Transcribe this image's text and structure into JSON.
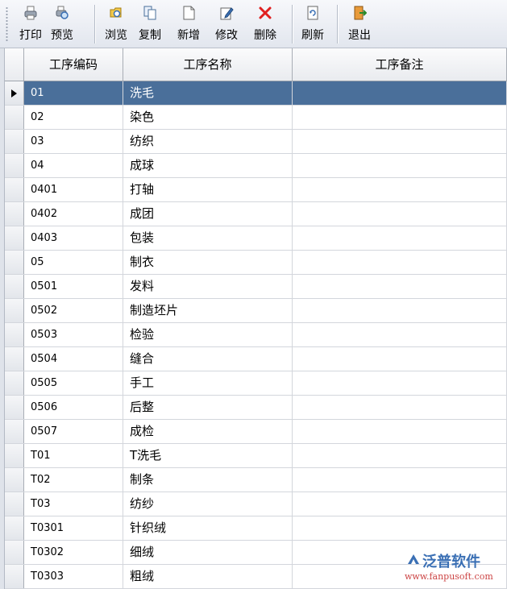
{
  "toolbar": {
    "buttons": [
      {
        "label": "打印",
        "icon": "printer-icon"
      },
      {
        "label": "预览",
        "icon": "print-preview-icon"
      },
      {
        "label": "浏览",
        "icon": "browse-icon"
      },
      {
        "label": "复制",
        "icon": "copy-icon"
      },
      {
        "label": "新增",
        "icon": "new-document-icon"
      },
      {
        "label": "修改",
        "icon": "edit-icon"
      },
      {
        "label": "删除",
        "icon": "delete-icon"
      },
      {
        "label": "刷新",
        "icon": "refresh-icon"
      },
      {
        "label": "退出",
        "icon": "exit-icon"
      }
    ]
  },
  "grid": {
    "columns": [
      "工序编码",
      "工序名称",
      "工序备注"
    ],
    "selected_row": 0,
    "rows": [
      {
        "code": "01",
        "name": "洗毛",
        "note": ""
      },
      {
        "code": "02",
        "name": "染色",
        "note": ""
      },
      {
        "code": "03",
        "name": "纺织",
        "note": ""
      },
      {
        "code": "04",
        "name": "成球",
        "note": ""
      },
      {
        "code": "0401",
        "name": "打轴",
        "note": ""
      },
      {
        "code": "0402",
        "name": "成团",
        "note": ""
      },
      {
        "code": "0403",
        "name": "包装",
        "note": ""
      },
      {
        "code": "05",
        "name": "制衣",
        "note": ""
      },
      {
        "code": "0501",
        "name": "发料",
        "note": ""
      },
      {
        "code": "0502",
        "name": "制造坯片",
        "note": ""
      },
      {
        "code": "0503",
        "name": "检验",
        "note": ""
      },
      {
        "code": "0504",
        "name": "缝合",
        "note": ""
      },
      {
        "code": "0505",
        "name": "手工",
        "note": ""
      },
      {
        "code": "0506",
        "name": "后整",
        "note": ""
      },
      {
        "code": "0507",
        "name": "成检",
        "note": ""
      },
      {
        "code": "T01",
        "name": "T洗毛",
        "note": ""
      },
      {
        "code": "T02",
        "name": "制条",
        "note": ""
      },
      {
        "code": "T03",
        "name": "纺纱",
        "note": ""
      },
      {
        "code": "T0301",
        "name": "针织绒",
        "note": ""
      },
      {
        "code": "T0302",
        "name": "细绒",
        "note": ""
      },
      {
        "code": "T0303",
        "name": "粗绒",
        "note": ""
      }
    ]
  },
  "watermark": {
    "brand": "泛普软件",
    "url": "www.fanpusoft.com"
  },
  "colors": {
    "selection": "#4a6f9a",
    "delete_icon": "#e02020",
    "watermark_brand": "#3a6fb4"
  }
}
